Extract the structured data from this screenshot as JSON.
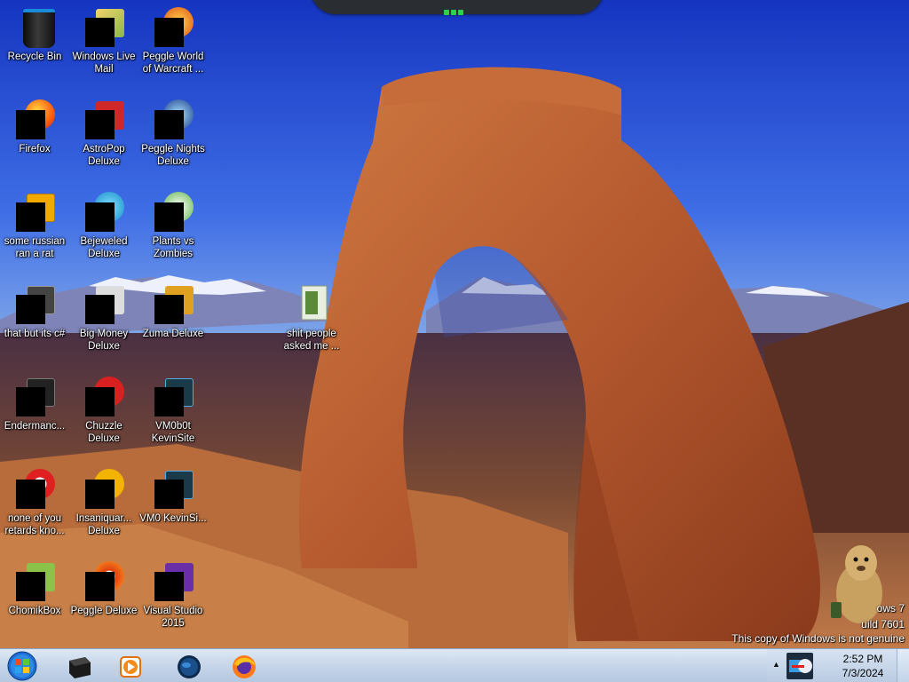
{
  "desktop": {
    "icons": [
      {
        "label": "Recycle Bin",
        "icon": "recycle-bin-icon"
      },
      {
        "label": "Windows Live Mail",
        "icon": "windows-live-mail-icon"
      },
      {
        "label": "Peggle World of Warcraft ...",
        "icon": "peggle-wow-icon"
      },
      {
        "label": "Firefox",
        "icon": "firefox-icon"
      },
      {
        "label": "AstroPop Deluxe",
        "icon": "astropop-icon"
      },
      {
        "label": "Peggle Nights Deluxe",
        "icon": "peggle-nights-icon"
      },
      {
        "label": "some russian ran a rat",
        "icon": "russian-rat-icon"
      },
      {
        "label": "Bejeweled Deluxe",
        "icon": "bejeweled-icon"
      },
      {
        "label": "Plants vs Zombies",
        "icon": "plants-vs-zombies-icon"
      },
      {
        "label": "that but its c#",
        "icon": "shortcut-file-icon"
      },
      {
        "label": "Big Money Deluxe",
        "icon": "big-money-icon"
      },
      {
        "label": "Zuma Deluxe",
        "icon": "zuma-icon"
      },
      {
        "label": "shit people asked me ...",
        "icon": "folder-icon"
      },
      {
        "label": "Endermanc...",
        "icon": "console-app-icon"
      },
      {
        "label": "Chuzzle Deluxe",
        "icon": "chuzzle-icon"
      },
      {
        "label": "VM0b0t KevinSite",
        "icon": "vm-icon"
      },
      {
        "label": "none of you retards kno...",
        "icon": "opera-icon"
      },
      {
        "label": "Insaniquar... Deluxe",
        "icon": "insaniquarium-icon"
      },
      {
        "label": "VM0 KevinSi...",
        "icon": "vm-icon"
      },
      {
        "label": "ChomikBox",
        "icon": "chomikbox-icon"
      },
      {
        "label": "Peggle Deluxe",
        "icon": "peggle-icon"
      },
      {
        "label": "Visual Studio 2015",
        "icon": "visual-studio-icon"
      }
    ],
    "watermark": {
      "line1": "ows 7",
      "line2": "uild 7601",
      "line3": "This copy of Windows is not genuine"
    }
  },
  "taskbar": {
    "start_icon": "windows-start-icon",
    "pinned": [
      {
        "name": "command-prompt-icon"
      },
      {
        "name": "media-player-icon"
      },
      {
        "name": "globe-browser-icon"
      },
      {
        "name": "firefox-icon"
      }
    ],
    "tray": {
      "overflow_icon": "chevron-up-icon",
      "app_icon": "network-tray-icon",
      "time": "2:52 PM",
      "date": "7/3/2024"
    }
  },
  "colors": {
    "taskbar": "#c8d7ea",
    "sky": "#2f55d8",
    "rock": "#b0582e"
  }
}
